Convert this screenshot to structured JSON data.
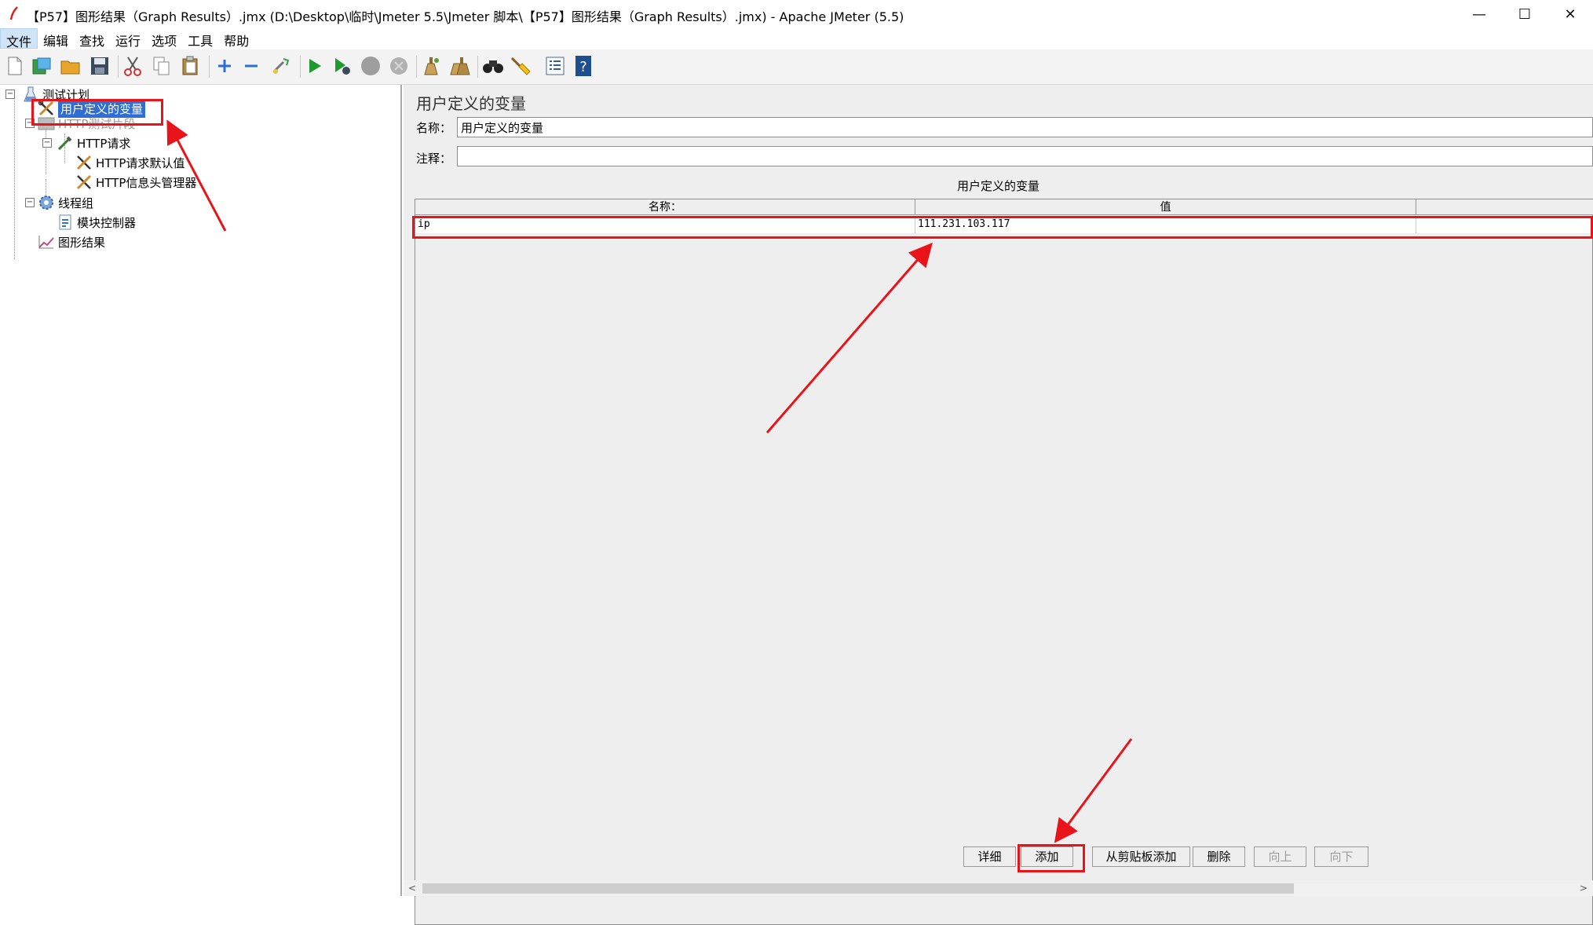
{
  "window": {
    "title": "【P57】图形结果（Graph Results）.jmx (D:\\Desktop\\临时\\Jmeter 5.5\\Jmeter 脚本\\【P57】图形结果（Graph Results）.jmx) - Apache JMeter (5.5)",
    "minimize": "—",
    "maximize": "☐",
    "close": "✕"
  },
  "menu": [
    "文件",
    "编辑",
    "查找",
    "运行",
    "选项",
    "工具",
    "帮助"
  ],
  "toolbar_icons": [
    "new-icon",
    "templates-icon",
    "open-icon",
    "save-icon",
    "cut-icon",
    "copy-icon",
    "paste-icon",
    "expand-icon",
    "collapse-icon",
    "toggle-icon",
    "start-icon",
    "start-no-pause-icon",
    "stop-icon",
    "shutdown-icon",
    "clear-icon",
    "clear-all-icon",
    "search-icon",
    "reset-search-icon",
    "function-helper-icon",
    "help-icon"
  ],
  "tree": {
    "plan": "测试计划",
    "udv": "用户定义的变量",
    "http_fragment": "HTTP测试片段",
    "http_request": "HTTP请求",
    "http_defaults": "HTTP请求默认值",
    "http_header": "HTTP信息头管理器",
    "thread_group": "线程组",
    "module_controller": "模块控制器",
    "graph_results": "图形结果"
  },
  "panel": {
    "title": "用户定义的变量",
    "name_label": "名称：",
    "name_value": "用户定义的变量",
    "comment_label": "注释：",
    "comment_value": "",
    "table_caption": "用户定义的变量",
    "columns": [
      "名称：",
      "值",
      ""
    ],
    "rows": [
      {
        "name": "ip",
        "value": "111.231.103.117",
        "desc": ""
      }
    ]
  },
  "buttons": {
    "detail": "详细",
    "add": "添加",
    "add_clipboard": "从剪贴板添加",
    "delete": "删除",
    "up": "向上",
    "down": "向下"
  },
  "scroll": {
    "left": "<",
    "right": ">"
  },
  "colors": {
    "annotation": "#e8141a",
    "selection": "#2f6fd3"
  }
}
